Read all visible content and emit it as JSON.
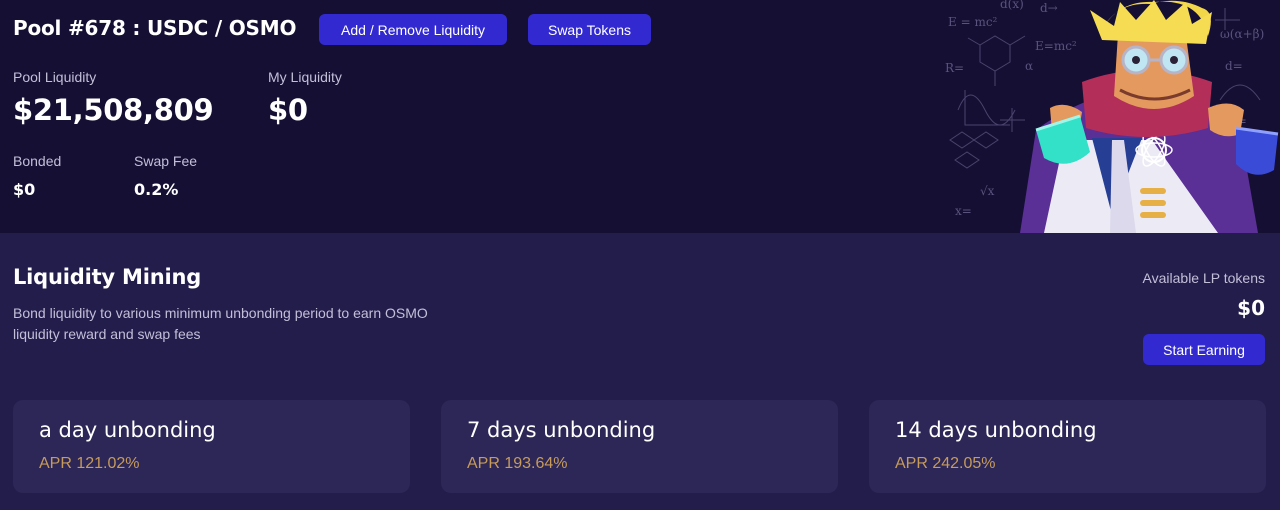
{
  "header": {
    "pool_title": "Pool #678 : USDC / OSMO",
    "add_remove_label": "Add / Remove Liquidity",
    "swap_label": "Swap Tokens"
  },
  "stats": {
    "pool_liquidity_label": "Pool Liquidity",
    "pool_liquidity_value": "$21,508,809",
    "my_liquidity_label": "My Liquidity",
    "my_liquidity_value": "$0",
    "bonded_label": "Bonded",
    "bonded_value": "$0",
    "swap_fee_label": "Swap Fee",
    "swap_fee_value": "0.2%"
  },
  "mining": {
    "title": "Liquidity Mining",
    "description": "Bond liquidity to various minimum unbonding period to earn OSMO liquidity reward and swap fees",
    "available_lp_label": "Available LP tokens",
    "available_lp_value": "$0",
    "start_earning_label": "Start Earning"
  },
  "unbonding_cards": [
    {
      "title": "a day unbonding",
      "apr": "APR 121.02%"
    },
    {
      "title": "7 days unbonding",
      "apr": "APR 193.64%"
    },
    {
      "title": "14 days unbonding",
      "apr": "APR 242.05%"
    }
  ],
  "colors": {
    "top_background": "#150f33",
    "page_background": "#231d4b",
    "card_background": "#2c2757",
    "button": "#322ad0",
    "apr_text": "#c79b5b"
  },
  "icons": {
    "illustration": "scientist-mascot-illustration"
  }
}
